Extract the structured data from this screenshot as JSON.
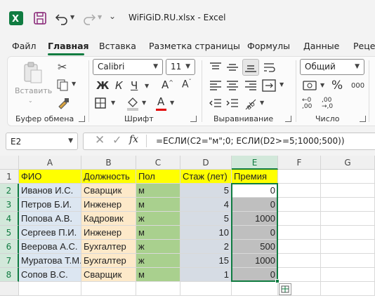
{
  "window": {
    "title": "WiFiGiD.RU.xlsx  -  Excel"
  },
  "menu": {
    "tabs": [
      "Файл",
      "Главная",
      "Вставка",
      "Разметка страницы",
      "Формулы",
      "Данные",
      "Рецен"
    ],
    "active": "Главная"
  },
  "ribbon": {
    "clipboard": {
      "label": "Буфер обмена",
      "paste_label": "Вставить"
    },
    "font": {
      "label": "Шрифт",
      "font_name": "Calibri",
      "font_size": "11"
    },
    "alignment": {
      "label": "Выравнивание"
    },
    "number": {
      "label": "Число",
      "format": "Общий",
      "zeros_label": "000"
    }
  },
  "formula_bar": {
    "name_box": "E2",
    "fx_label": "fx",
    "formula": "=ЕСЛИ(C2=\"м\";0; ЕСЛИ(D2>=5;1000;500))"
  },
  "sheet": {
    "columns": [
      "A",
      "B",
      "C",
      "D",
      "E",
      "F",
      "G"
    ],
    "rows": [
      "1",
      "2",
      "3",
      "4",
      "5",
      "6",
      "7",
      "8"
    ],
    "selected_column": "E",
    "header_row": [
      "ФИО",
      "Должность",
      "Пол",
      "Стаж (лет)",
      "Премия"
    ],
    "data": [
      [
        "Иванов И.С.",
        "Сварщик",
        "м",
        "5",
        "0"
      ],
      [
        "Петров Б.И.",
        "Инженер",
        "м",
        "4",
        "0"
      ],
      [
        "Попова А.В.",
        "Кадровик",
        "ж",
        "5",
        "1000"
      ],
      [
        "Сергеев П.И.",
        "Инженер",
        "м",
        "10",
        "0"
      ],
      [
        "Веерова А.С.",
        "Бухгалтер",
        "ж",
        "2",
        "500"
      ],
      [
        "Муратова Т.М.",
        "Бухгалтер",
        "ж",
        "15",
        "1000"
      ],
      [
        "Сопов В.С.",
        "Сварщик",
        "м",
        "1",
        "0"
      ]
    ],
    "colors": {
      "header_fill": "#ffff00",
      "fio_fill": "#dce6f1",
      "position_fill": "#fde9c9",
      "gender_fill": "#a9d08e",
      "experience_fill": "#d6dce4",
      "bonus_fill": "#bfbfbf",
      "accent": "#107c41"
    }
  }
}
